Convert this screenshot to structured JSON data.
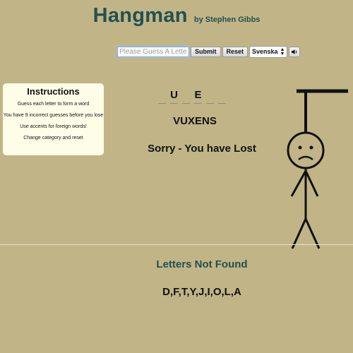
{
  "header": {
    "title": "Hangman",
    "byline": "by Stephen Gibbs"
  },
  "controls": {
    "guess_placeholder": "Please Guess A Letter",
    "guess_value": "",
    "submit_label": "Submit",
    "reset_label": "Reset",
    "language_selected": "Svenska",
    "sound_icon": "speaker-icon"
  },
  "instructions": {
    "title": "Instructions",
    "lines": [
      "Guess each letter to form a word",
      "You have 9 incorrect guesses before you lose",
      "Use accents for foreign words!",
      "Change category and reset"
    ]
  },
  "game": {
    "slots": [
      "",
      "U",
      "",
      "E",
      "",
      ""
    ],
    "answer": "VUXENS",
    "status": "Sorry - You have Lost",
    "missed_title": "Letters Not Found",
    "missed_letters": "D,F,T,Y,J,I,O,L,A",
    "incorrect_guesses": 9,
    "max_incorrect": 9
  },
  "colors": {
    "background": "#c1b487",
    "accent": "#23504f",
    "instructions_bg": "#fdfde8"
  }
}
